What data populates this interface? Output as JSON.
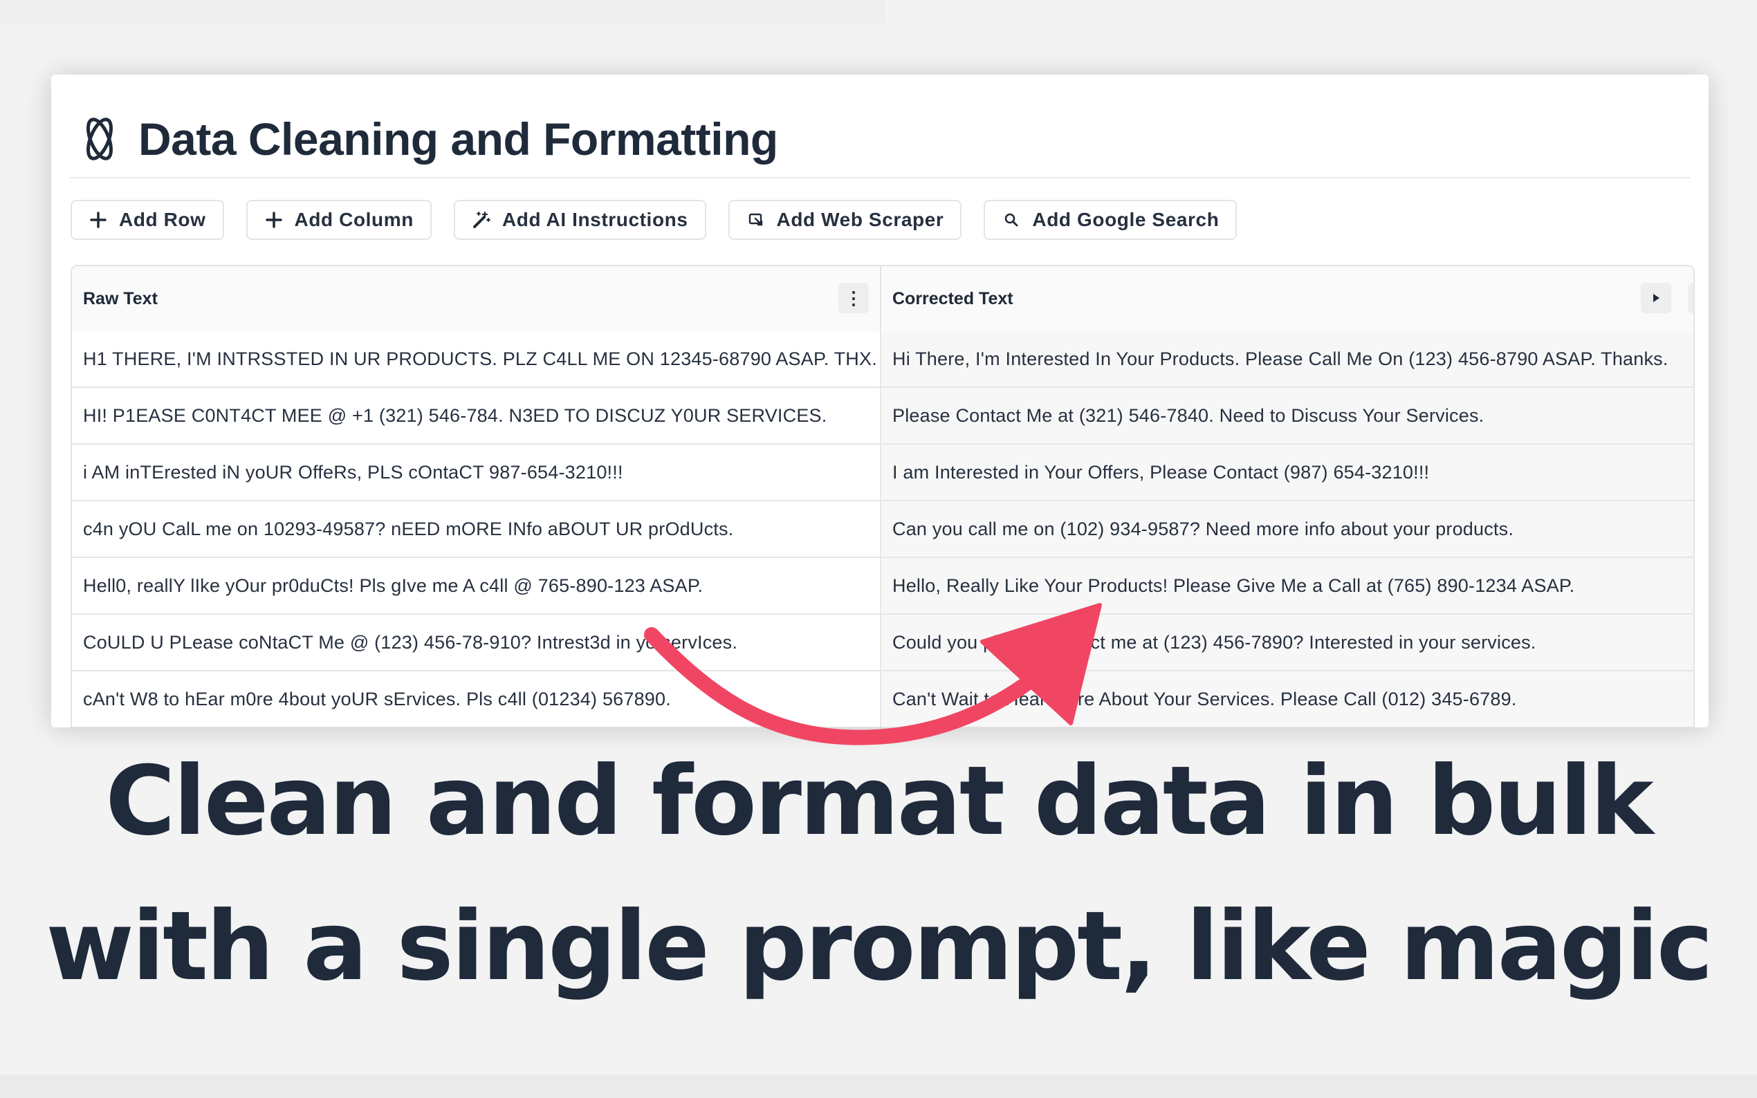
{
  "app": {
    "title": "Data Cleaning and Formatting"
  },
  "toolbar": {
    "add_row": "Add Row",
    "add_column": "Add Column",
    "add_ai_instructions": "Add AI Instructions",
    "add_web_scraper": "Add Web Scraper",
    "add_google_search": "Add Google Search"
  },
  "table": {
    "columns": [
      "Raw Text",
      "Corrected Text"
    ],
    "column_menu_icon": "⋮",
    "rows": [
      [
        "H1 THERE, I'M INTRSSTED IN UR PRODUCTS. PLZ C4LL ME ON 12345-68790 ASAP. THX.",
        "Hi There, I'm Interested In Your Products. Please Call Me On (123) 456-8790 ASAP. Thanks."
      ],
      [
        "HI! P1EASE C0NT4CT MEE @ +1 (321) 546-784. N3ED TO DISCUZ Y0UR SERVICES.",
        "Please Contact Me at (321) 546-7840. Need to Discuss Your Services."
      ],
      [
        "i AM inTErested iN yoUR OffeRs, PLS cOntaCT 987-654-3210!!!",
        "I am Interested in Your Offers, Please Contact (987) 654-3210!!!"
      ],
      [
        "c4n yOU CalL me on 10293-49587? nEED mORE INfo aBOUT UR prOdUcts.",
        "Can you call me on (102) 934-9587? Need more info about your products."
      ],
      [
        "Hell0, reallY lIke yOur pr0duCts! Pls gIve me A c4ll @ 765-890-123 ASAP.",
        "Hello, Really Like Your Products! Please Give Me a Call at (765) 890-1234 ASAP."
      ],
      [
        "CoULD U PLease coNtaCT Me @ (123) 456-78-910? Intrest3d in yo servIces.",
        "Could you please contact me at (123) 456-7890? Interested in your services."
      ],
      [
        "cAn't W8 to hEar m0re 4bout yoUR sErvices. Pls c4ll (01234) 567890.",
        "Can't Wait to Hear More About Your Services. Please Call (012) 345-6789."
      ]
    ]
  },
  "headline": {
    "line1": "Clean and format data in bulk",
    "line2": "with a single prompt, like magic"
  },
  "colors": {
    "arrow": "#f04663",
    "headline": "#1f2a3b",
    "title": "#1f2a3a"
  }
}
